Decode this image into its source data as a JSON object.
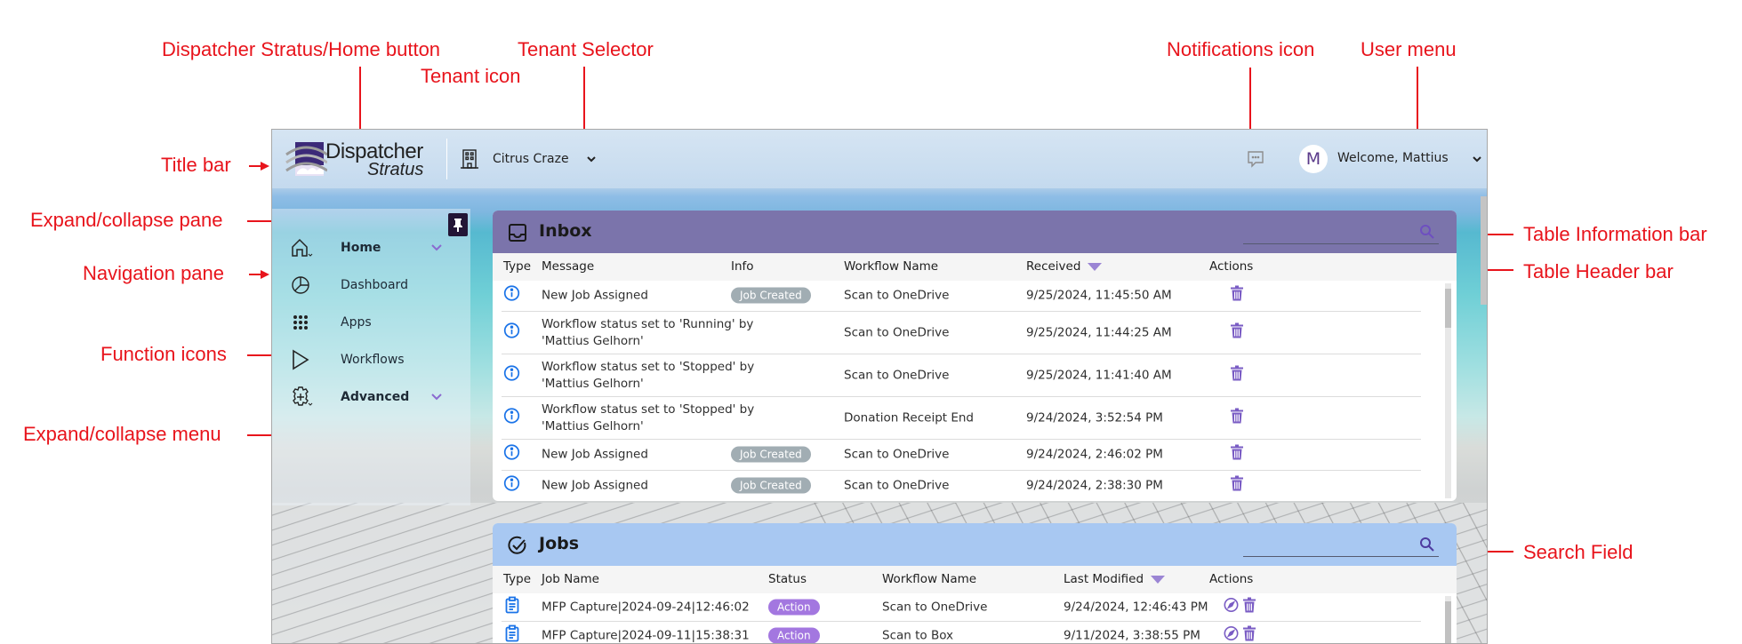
{
  "annotations": {
    "home_button": "Dispatcher Stratus/Home button",
    "tenant_selector": "Tenant Selector",
    "tenant_icon": "Tenant icon",
    "notifications_icon": "Notifications icon",
    "user_menu": "User menu",
    "title_bar": "Title bar",
    "expand_collapse_pane": "Expand/collapse pane",
    "navigation_pane": "Navigation pane",
    "function_icons": "Function icons",
    "expand_collapse_menu": "Expand/collapse menu",
    "table_information_bar": "Table Information bar",
    "table_header_bar": "Table Header bar",
    "search_field": "Search Field"
  },
  "titlebar": {
    "logo_line1": "Dispatcher",
    "logo_line2": "Stratus",
    "tenant_name": "Citrus Craze",
    "tenant_icon": "building-icon",
    "notifications_icon": "chat-bubble-icon",
    "avatar_initial": "M",
    "welcome_text": "Welcome, Mattius"
  },
  "nav": {
    "pin_icon": "pin-icon",
    "items": [
      {
        "label": "Home",
        "icon": "home-icon",
        "expandable": true,
        "bold": true
      },
      {
        "label": "Dashboard",
        "icon": "pie-chart-icon",
        "expandable": false
      },
      {
        "label": "Apps",
        "icon": "grid-dots-icon",
        "expandable": false
      },
      {
        "label": "Workflows",
        "icon": "play-icon",
        "expandable": false
      },
      {
        "label": "Advanced",
        "icon": "gear-plus-icon",
        "expandable": true,
        "bold": true
      }
    ]
  },
  "inbox": {
    "title": "Inbox",
    "icon": "inbox-tray-icon",
    "search_placeholder": "",
    "columns": [
      "Type",
      "Message",
      "Info",
      "Workflow Name",
      "Received",
      "Actions"
    ],
    "sorted_column": "Received",
    "rows": [
      {
        "type": "info-icon",
        "message": "New Job Assigned",
        "info": "Job Created",
        "workflow": "Scan to OneDrive",
        "received": "9/25/2024, 11:45:50 AM"
      },
      {
        "type": "info-icon",
        "message": "Workflow status set to 'Running' by 'Mattius Gelhorn'",
        "info": "",
        "workflow": "Scan to OneDrive",
        "received": "9/25/2024, 11:44:25 AM"
      },
      {
        "type": "info-icon",
        "message": "Workflow status set to 'Stopped' by 'Mattius Gelhorn'",
        "info": "",
        "workflow": "Scan to OneDrive",
        "received": "9/25/2024, 11:41:40 AM"
      },
      {
        "type": "info-icon",
        "message": "Workflow status set to 'Stopped' by 'Mattius Gelhorn'",
        "info": "",
        "workflow": "Donation Receipt End",
        "received": "9/24/2024, 3:52:54 PM"
      },
      {
        "type": "info-icon",
        "message": "New Job Assigned",
        "info": "Job Created",
        "workflow": "Scan to OneDrive",
        "received": "9/24/2024, 2:46:02 PM"
      },
      {
        "type": "info-icon",
        "message": "New Job Assigned",
        "info": "Job Created",
        "workflow": "Scan to OneDrive",
        "received": "9/24/2024, 2:38:30 PM"
      }
    ]
  },
  "jobs": {
    "title": "Jobs",
    "icon": "check-circle-icon",
    "search_placeholder": "",
    "columns": [
      "Type",
      "Job Name",
      "Status",
      "Workflow Name",
      "Last Modified",
      "Actions"
    ],
    "sorted_column": "Last Modified",
    "rows": [
      {
        "type": "clipboard-icon",
        "job_name": "MFP Capture|2024-09-24|12:46:02",
        "status": "Action",
        "workflow": "Scan to OneDrive",
        "last_modified": "9/24/2024, 12:46:43 PM"
      },
      {
        "type": "clipboard-icon",
        "job_name": "MFP Capture|2024-09-11|15:38:31",
        "status": "Action",
        "workflow": "Scan to Box",
        "last_modified": "9/11/2024, 3:38:55 PM"
      }
    ]
  },
  "colors": {
    "annotation": "#e8141c",
    "inbox_bar": "#7b74ab",
    "jobs_bar": "#a8c8f2",
    "accent_purple": "#7a5cc4",
    "info_blue": "#1a73e8",
    "badge_grey": "#a1adb3",
    "badge_purple": "#a377e0"
  }
}
